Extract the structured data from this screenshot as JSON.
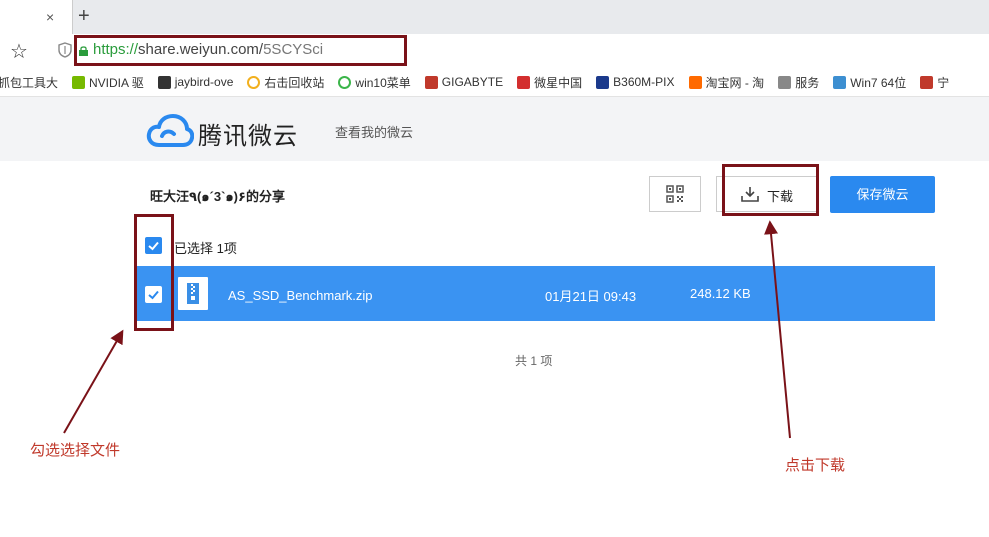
{
  "browser": {
    "tab_close_glyph": "×",
    "new_tab_glyph": "+",
    "url_proto": "https://",
    "url_host": "share.weiyun.com/",
    "url_path": "5SCYSci",
    "bookmarks": [
      {
        "label": "抓包工具大",
        "icon": "none",
        "color": ""
      },
      {
        "label": "NVIDIA 驱",
        "icon": "nvidia-icon",
        "color": "#76b900"
      },
      {
        "label": "jaybird-ove",
        "icon": "jaybird-icon",
        "color": "#333333"
      },
      {
        "label": "右击回收站",
        "icon": "circle-icon",
        "color": "#f2b01e"
      },
      {
        "label": "win10菜单",
        "icon": "circle-icon",
        "color": "#3bb54a"
      },
      {
        "label": "GIGABYTE",
        "icon": "gigabyte-icon",
        "color": "#c0392b"
      },
      {
        "label": "微星中国",
        "icon": "msi-icon",
        "color": "#d32f2f"
      },
      {
        "label": "B360M-PIX",
        "icon": "b360-icon",
        "color": "#1b3a8c"
      },
      {
        "label": "淘宝网 - 淘",
        "icon": "taobao-icon",
        "color": "#ff6a00"
      },
      {
        "label": "服务",
        "icon": "service-icon",
        "color": "#888888"
      },
      {
        "label": "Win7 64位",
        "icon": "win7-icon",
        "color": "#3d8fd1"
      },
      {
        "label": "宁",
        "icon": "ning-icon",
        "color": "#c0392b"
      }
    ]
  },
  "header": {
    "brand": "腾讯微云",
    "my_cloud_link": "查看我的微云"
  },
  "share": {
    "title": "旺大汪٩(๑´3`๑)۶的分享",
    "download_label": "下载",
    "save_label": "保存微云",
    "selected_text": "已选择 1项",
    "total_text": "共 1 项"
  },
  "file": {
    "name": "AS_SSD_Benchmark.zip",
    "date": "01月21日 09:43",
    "size": "248.12 KB",
    "checked": true
  },
  "annotations": {
    "select_note": "勾选选择文件",
    "download_note": "点击下载",
    "color": "#7a1218"
  },
  "colors": {
    "accent": "#2a89ef",
    "selected_row": "#3a93f2"
  }
}
